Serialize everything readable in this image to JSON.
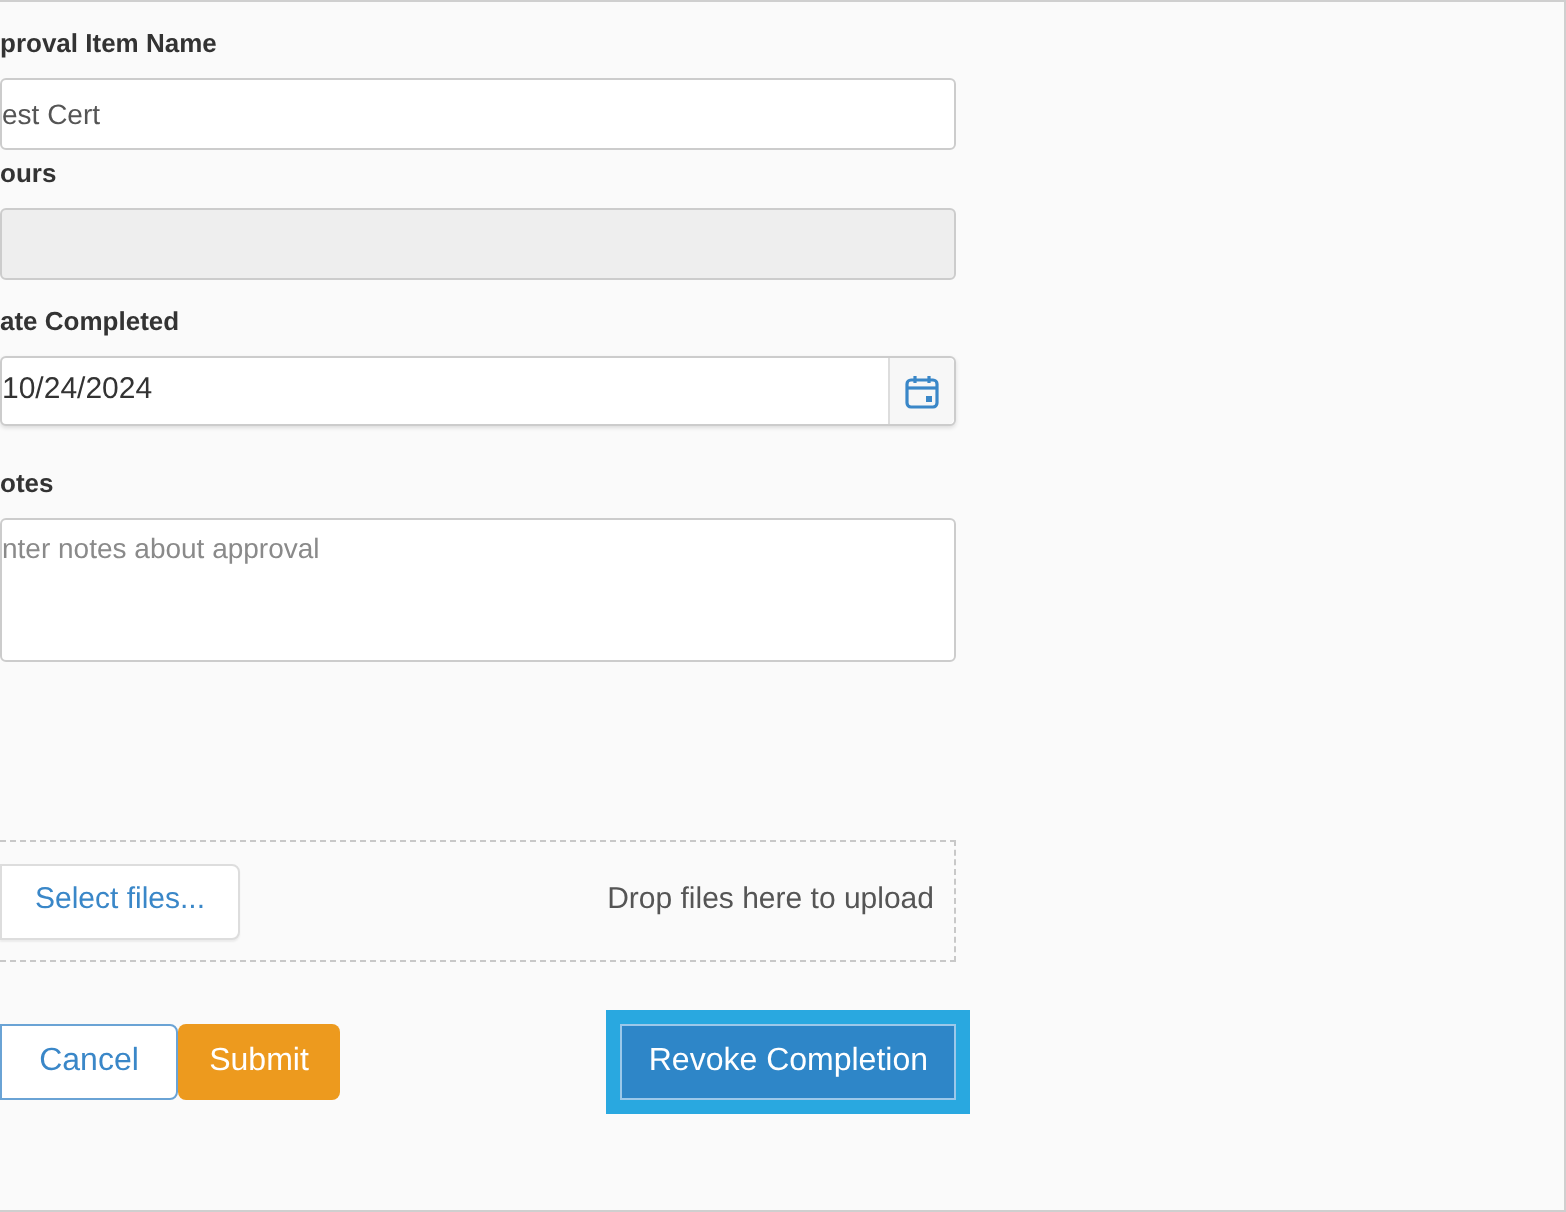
{
  "fields": [
    {
      "kind": "text",
      "label": "proval Item Name",
      "value": "est Cert",
      "disabled": false
    },
    {
      "kind": "text",
      "label": "ours",
      "disabled": true
    },
    {
      "kind": "date",
      "label": "ate Completed",
      "value": "10/24/2024",
      "disabled": false
    },
    {
      "kind": "textarea",
      "label": "otes",
      "placeholder": "nter notes about approval",
      "disabled": false
    }
  ],
  "upload": {
    "button": "Select files...",
    "hint": "Drop files here to upload"
  },
  "buttons": [
    {
      "kind": "secondary",
      "label": "Cancel",
      "focused": false
    },
    {
      "kind": "primary",
      "label": "Submit",
      "focused": false
    },
    {
      "kind": "action",
      "label": "Revoke Completion",
      "focused": true
    }
  ]
}
